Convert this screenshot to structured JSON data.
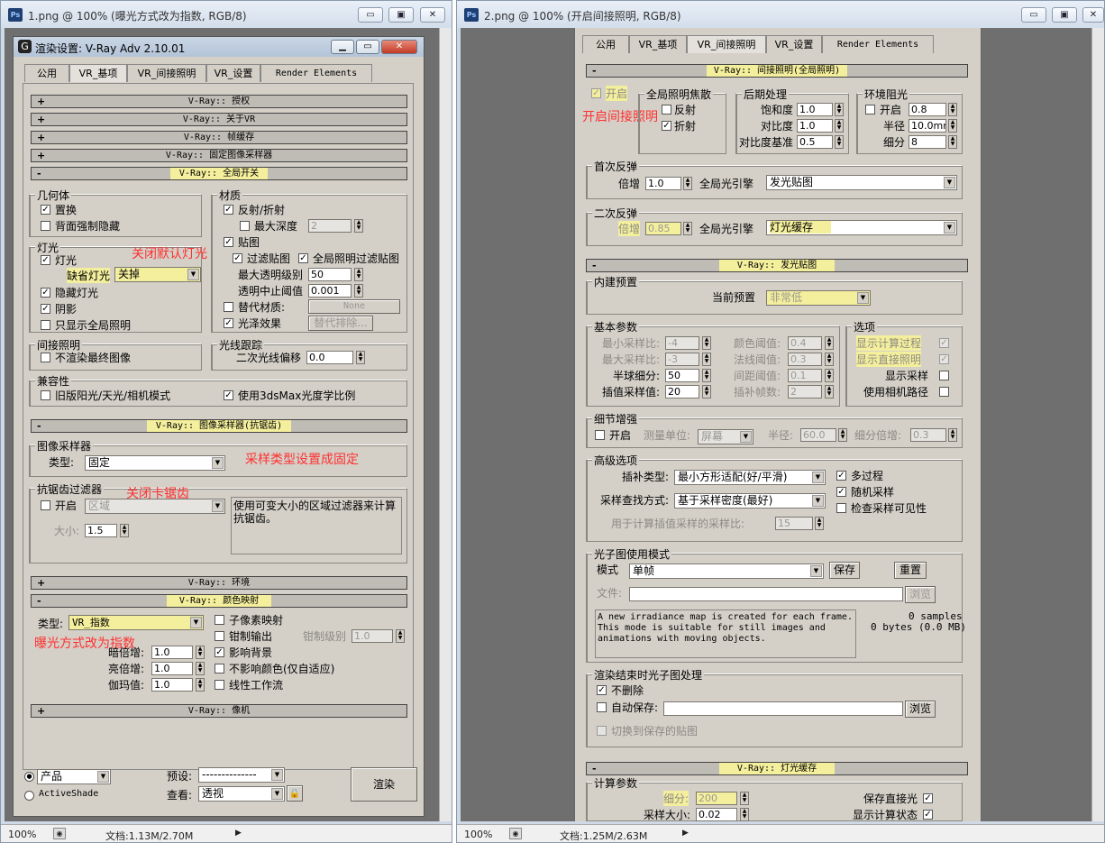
{
  "left": {
    "title": "1.png @ 100% (曝光方式改为指数, RGB/8)",
    "ps_icon": "Ps",
    "win_min": "▭",
    "win_restore": "▣",
    "win_close": "✕",
    "status_zoom": "100%",
    "status_doc": "文档:1.13M/2.70M",
    "dialog": {
      "title": "渲染设置: V-Ray Adv 2.10.01",
      "tabs": [
        "公用",
        "VR_基项",
        "VR_间接照明",
        "VR_设置",
        "Render Elements"
      ],
      "rollouts": {
        "auth": "V-Ray:: 授权",
        "about": "V-Ray:: 关于VR",
        "framebuffer": "V-Ray:: 帧缓存",
        "fixed_sampler": "V-Ray:: 固定图像采样器",
        "global_switch": "V-Ray:: 全局开关",
        "image_sampler": "V-Ray:: 图像采样器(抗锯齿)",
        "environment": "V-Ray:: 环境",
        "color_mapping": "V-Ray:: 颜色映射",
        "camera": "V-Ray:: 像机"
      },
      "geometry": {
        "title": "几何体",
        "displacement": "置换",
        "backface": "背面强制隐藏"
      },
      "lights": {
        "title": "灯光",
        "lights": "灯光",
        "default_lights_label": "缺省灯光",
        "default_lights_value": "关掉",
        "hidden_lights": "隐藏灯光",
        "shadows": "阴影",
        "show_gi_only": "只显示全局照明"
      },
      "materials": {
        "title": "材质",
        "reflect_refract": "反射/折射",
        "max_depth": "最大深度",
        "max_depth_value": "2",
        "maps": "贴图",
        "filter_maps": "过滤贴图",
        "gi_filter_maps": "全局照明过滤贴图",
        "max_transp_levels": "最大透明级别",
        "max_transp_value": "50",
        "transp_cutoff": "透明中止阈值",
        "transp_cutoff_value": "0.001",
        "override_mtl": "替代材质:",
        "override_value": "None",
        "glossy": "光泽效果",
        "override_exclude": "替代排除..."
      },
      "indirect": {
        "title": "间接照明",
        "dont_render_final": "不渲染最终图像"
      },
      "raytrace": {
        "title": "光线跟踪",
        "secondary_bias": "二次光线偏移",
        "secondary_bias_value": "0.0"
      },
      "compat": {
        "title": "兼容性",
        "legacy": "旧版阳光/天光/相机模式",
        "use_3dsmax": "使用3dsMax光度学比例"
      },
      "sampler": {
        "title": "图像采样器",
        "type_label": "类型:",
        "type_value": "固定"
      },
      "aa_filter": {
        "title": "抗锯齿过滤器",
        "on": "开启",
        "filter_value": "区域",
        "size_label": "大小:",
        "size_value": "1.5",
        "desc": "使用可变大小的区域过滤器来计算抗锯齿。"
      },
      "colormap": {
        "type_label": "类型:",
        "type_value": "VR_指数",
        "dark_mult": "暗倍增:",
        "dark_value": "1.0",
        "bright_mult": "亮倍增:",
        "bright_value": "1.0",
        "gamma": "伽玛值:",
        "gamma_value": "1.0",
        "subpixel": "子像素映射",
        "clamp": "钳制输出",
        "clamp_level": "钳制级别",
        "clamp_level_value": "1.0",
        "affect_bg": "影响背景",
        "no_affect_colors": "不影响颜色(仅自适应)",
        "linear": "线性工作流"
      },
      "bottom": {
        "product": "产品",
        "activeshade": "ActiveShade",
        "preset_label": "预设:",
        "preset_value": "--------------",
        "view_label": "查看:",
        "view_value": "透视",
        "render": "渲染",
        "lock": "🔒"
      },
      "annotations": {
        "close_default": "关闭默认灯光",
        "sampler_fixed": "采样类型设置成固定",
        "close_aa": "关闭卡锯齿",
        "exposure": "曝光方式改为指数"
      }
    }
  },
  "right": {
    "title": "2.png @ 100% (开启间接照明, RGB/8)",
    "ps_icon": "Ps",
    "win_min": "▭",
    "win_restore": "▣",
    "win_close": "✕",
    "status_zoom": "100%",
    "status_doc": "文档:1.25M/2.63M",
    "tabs": [
      "公用",
      "VR_基项",
      "VR_间接照明",
      "VR_设置",
      "Render Elements"
    ],
    "rollouts": {
      "gi": "V-Ray:: 间接照明(全局照明)",
      "irradiance": "V-Ray:: 发光贴图",
      "lightcache": "V-Ray:: 灯光缓存"
    },
    "gi": {
      "on": "开启",
      "caustics_title": "全局照明焦散",
      "reflective": "反射",
      "refractive": "折射",
      "post_title": "后期处理",
      "saturation": "饱和度",
      "saturation_value": "1.0",
      "contrast": "对比度",
      "contrast_value": "1.0",
      "contrast_base": "对比度基准",
      "contrast_base_value": "0.5",
      "ao_title": "环境阻光",
      "ao_on": "开启",
      "ao_amount_value": "0.8",
      "ao_radius": "半径",
      "ao_radius_value": "10.0mm",
      "ao_subdivs": "细分",
      "ao_subdivs_value": "8",
      "annotation": "开启间接照明"
    },
    "primary": {
      "title": "首次反弹",
      "mult": "倍增",
      "mult_value": "1.0",
      "engine": "全局光引擎",
      "engine_value": "发光贴图"
    },
    "secondary": {
      "title": "二次反弹",
      "mult": "倍增",
      "mult_value": "0.85",
      "engine": "全局光引擎",
      "engine_value": "灯光缓存"
    },
    "irr": {
      "builtin_title": "内建预置",
      "current_preset": "当前预置",
      "preset_value": "非常低",
      "basic_title": "基本参数",
      "min_rate": "最小采样比:",
      "min_rate_value": "-4",
      "max_rate": "最大采样比:",
      "max_rate_value": "-3",
      "hsph": "半球细分:",
      "hsph_value": "50",
      "interp": "插值采样值:",
      "interp_value": "20",
      "clr_thresh": "颜色阈值:",
      "clr_value": "0.4",
      "nrm_thresh": "法线阈值:",
      "nrm_value": "0.3",
      "dist_thresh": "间距阈值:",
      "dist_value": "0.1",
      "interp_frames": "插补帧数:",
      "interp_frames_value": "2",
      "options_title": "选项",
      "show_calc": "显示计算过程",
      "show_direct": "显示直接照明",
      "show_samples": "显示采样",
      "use_cam_path": "使用相机路径",
      "detail_title": "细节增强",
      "detail_on": "开启",
      "scale_units": "测量单位:",
      "scale_value": "屏幕",
      "radius": "半径:",
      "radius_value": "60.0",
      "subdivs_mult": "细分倍增:",
      "subdivs_mult_value": "0.3",
      "adv_title": "高级选项",
      "interp_type": "插补类型:",
      "interp_type_value": "最小方形适配(好/平滑)",
      "lookup": "采样查找方式:",
      "lookup_value": "基于采样密度(最好)",
      "calc_pass": "用于计算插值采样的采样比:",
      "calc_pass_value": "15",
      "multipass": "多过程",
      "randomize": "随机采样",
      "check_vis": "检查采样可见性",
      "mode_title": "光子图使用模式",
      "mode": "模式",
      "mode_value": "单帧",
      "save": "保存",
      "reset": "重置",
      "file": "文件:",
      "browse": "浏览",
      "mode_desc": "A new irradiance map is created for each frame. This mode is suitable for still images and animations with moving objects.",
      "samples": "0 samples",
      "bytes": "0 bytes (0.0 MB)",
      "after_title": "渲染结束时光子图处理",
      "dont_delete": "不删除",
      "auto_save": "自动保存:",
      "browse2": "浏览",
      "switch_saved": "切换到保存的贴图"
    },
    "lc": {
      "calc_title": "计算参数",
      "subdivs": "细分:",
      "subdivs_value": "200",
      "sample_size": "采样大小:",
      "sample_size_value": "0.02",
      "store_direct": "保存直接光",
      "show_calc": "显示计算状态"
    }
  }
}
